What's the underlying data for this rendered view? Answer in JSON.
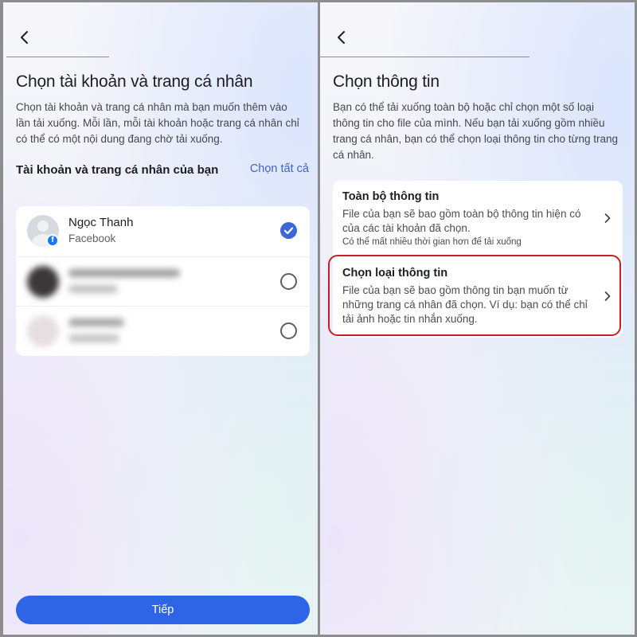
{
  "left": {
    "title": "Chọn tài khoản và trang cá nhân",
    "description": "Chọn tài khoản và trang cá nhân mà bạn muốn thêm vào lần tải xuống. Mỗi lần, mỗi tài khoản hoặc trang cá nhân chỉ có thể có một nội dung đang chờ tải xuống.",
    "section_title": "Tài khoản và trang cá nhân của bạn",
    "select_all": "Chọn tất cả",
    "accounts": [
      {
        "name": "Ngọc Thanh",
        "platform": "Facebook",
        "checked": true
      },
      {
        "name": "",
        "platform": "",
        "checked": false,
        "blurred": true
      },
      {
        "name": "",
        "platform": "",
        "checked": false,
        "blurred": true
      }
    ],
    "next_button": "Tiếp",
    "icons": {
      "back": "back-arrow-icon",
      "check": "checkmark-icon",
      "badge": "facebook-badge-icon"
    },
    "badge_letter": "f"
  },
  "right": {
    "title": "Chọn thông tin",
    "description": "Bạn có thể tải xuống toàn bộ hoặc chỉ chọn một số loại thông tin cho file của mình. Nếu bạn tải xuống gồm nhiều trang cá nhân, bạn có thể chọn loại thông tin cho từng trang cá nhân.",
    "options": [
      {
        "title": "Toàn bộ thông tin",
        "description": "File của bạn sẽ bao gồm toàn bộ thông tin hiện có của các tài khoản đã chọn.",
        "note": "Có thể mất nhiều thời gian hơn để tải xuống"
      },
      {
        "title": "Chọn loại thông tin",
        "description": "File của bạn sẽ bao gồm thông tin bạn muốn từ những trang cá nhân đã chọn. Ví dụ: bạn có thể chỉ tải ảnh hoặc tin nhắn xuống.",
        "highlighted": true
      }
    ]
  },
  "colors": {
    "accent": "#2e64e6",
    "link": "#3f64c4",
    "highlight": "#c52026"
  }
}
